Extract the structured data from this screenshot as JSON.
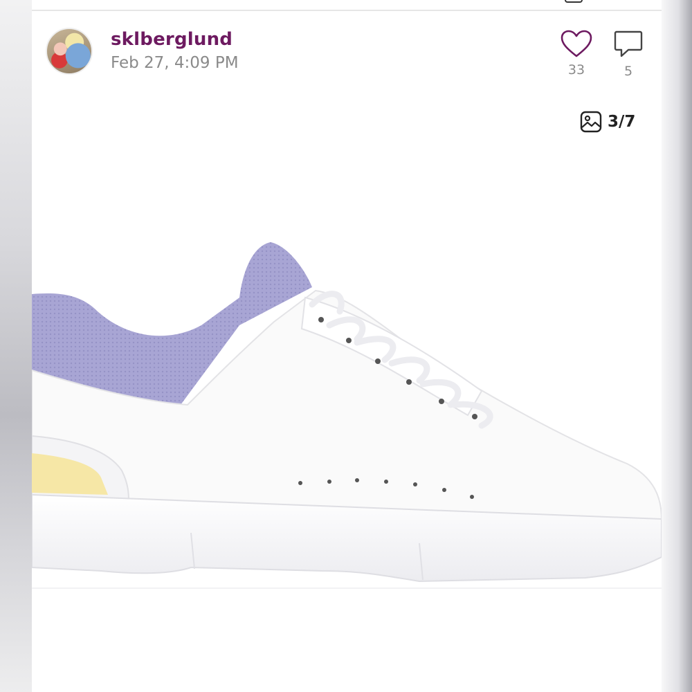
{
  "post": {
    "username": "sklberglund",
    "timestamp": "Feb 27, 4:09 PM",
    "likes": "33",
    "comments": "5",
    "photo_index": "3/7"
  },
  "icons": {
    "like": "heart-outline-icon",
    "comment": "speech-bubble-icon",
    "photo_counter": "image-icon"
  },
  "colors": {
    "username": "#6d1a60",
    "like_icon": "#6d1a60",
    "muted_text": "#8a8a8a",
    "shoe_collar": "#a8a5d4",
    "shoe_heel_accent": "#f6e7a6"
  }
}
